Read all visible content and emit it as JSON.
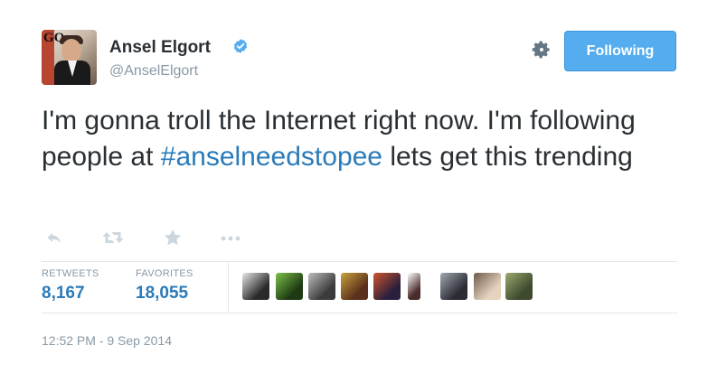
{
  "user": {
    "name": "Ansel Elgort",
    "handle": "@AnselElgort",
    "avatar_text": "GQ",
    "verified": true
  },
  "follow_button": {
    "label": "Following"
  },
  "tweet": {
    "text_before": "I'm gonna troll the Internet right now. I'm following people at ",
    "hashtag": "#anselneedstopee",
    "text_after": " lets get this trending"
  },
  "actions": [
    "reply-icon",
    "retweet-icon",
    "favorite-icon",
    "more-icon"
  ],
  "stats": {
    "retweets_label": "RETWEETS",
    "retweets_value": "8,167",
    "favorites_label": "FAVORITES",
    "favorites_value": "18,055"
  },
  "favoriter_avatars": [
    {
      "name": "favoriter-1",
      "colors": [
        "#e8e8e8",
        "#2a2a2a"
      ]
    },
    {
      "name": "favoriter-2",
      "colors": [
        "#7cc24a",
        "#1e3a12"
      ]
    },
    {
      "name": "favoriter-3",
      "colors": [
        "#bdbdbd",
        "#3b3b3b"
      ]
    },
    {
      "name": "favoriter-4",
      "colors": [
        "#c9a23d",
        "#5a2f1b"
      ]
    },
    {
      "name": "favoriter-5",
      "colors": [
        "#d0552b",
        "#2a1f3d"
      ]
    },
    {
      "name": "favoriter-6",
      "colors": [
        "#ffffff",
        "#4a2b2b"
      ]
    },
    {
      "name": "favoriter-7",
      "colors": [
        "#a0a8b0",
        "#2c2c35"
      ]
    },
    {
      "name": "favoriter-8",
      "colors": [
        "#6b5b4a",
        "#e6d3bf"
      ]
    },
    {
      "name": "favoriter-9",
      "colors": [
        "#9aaa6d",
        "#3e4a2e"
      ]
    }
  ],
  "timestamp": "12:52 PM - 9 Sep 2014",
  "colors": {
    "link": "#2b7bb9",
    "button": "#55acee",
    "muted": "#8899a6",
    "text": "#292f33"
  }
}
